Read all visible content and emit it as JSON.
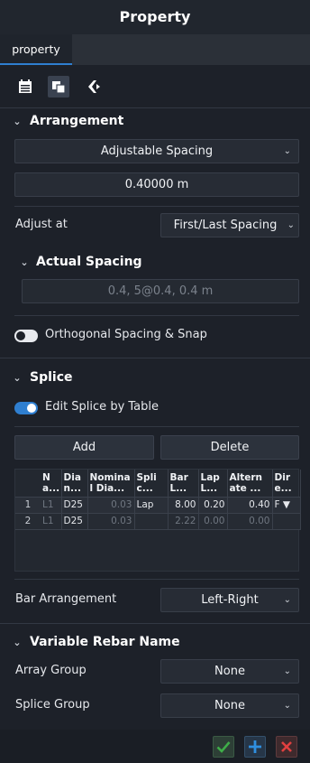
{
  "title": "Property",
  "tabs": [
    {
      "label": "property",
      "active": true
    }
  ],
  "toolbar": {
    "icons": [
      "calendar-icon",
      "layers-icon",
      "rebar-shape-icon"
    ]
  },
  "arrangement": {
    "header": "Arrangement",
    "spacing_type": "Adjustable Spacing",
    "spacing_value": "0.40000 m",
    "adjust_at_label": "Adjust at",
    "adjust_at_value": "First/Last Spacing",
    "actual_spacing": {
      "header": "Actual Spacing",
      "value": "0.4, 5@0.4, 0.4 m"
    },
    "orthogonal_label": "Orthogonal Spacing & Snap",
    "orthogonal_on": false
  },
  "splice": {
    "header": "Splice",
    "edit_by_table_label": "Edit Splice by Table",
    "edit_by_table_on": true,
    "add_label": "Add",
    "delete_label": "Delete",
    "table": {
      "columns": [
        "N\na...",
        "Dia\nn...",
        "Nomina\nl Dia...",
        "Spli\nc...",
        "Bar\nL...",
        "Lap\nL...",
        "Altern\nate ...",
        "Dir\ne..."
      ],
      "rows": [
        {
          "index": "1",
          "cells": [
            "L1",
            "D25",
            "0.03",
            "Lap",
            "8.00",
            "0.20",
            "0.40",
            "F ▼"
          ]
        },
        {
          "index": "2",
          "cells": [
            "L1",
            "D25",
            "0.03",
            "",
            "2.22",
            "0.00",
            "0.00",
            ""
          ]
        }
      ]
    },
    "bar_arrangement_label": "Bar Arrangement",
    "bar_arrangement_value": "Left-Right"
  },
  "variable_rebar": {
    "header": "Variable Rebar Name",
    "array_group_label": "Array Group",
    "array_group_value": "None",
    "splice_group_label": "Splice Group",
    "splice_group_value": "None"
  },
  "colors": {
    "accent": "#2f7fd0",
    "ok": "#3fae49",
    "add": "#2f8fe0",
    "cancel": "#e04040"
  }
}
